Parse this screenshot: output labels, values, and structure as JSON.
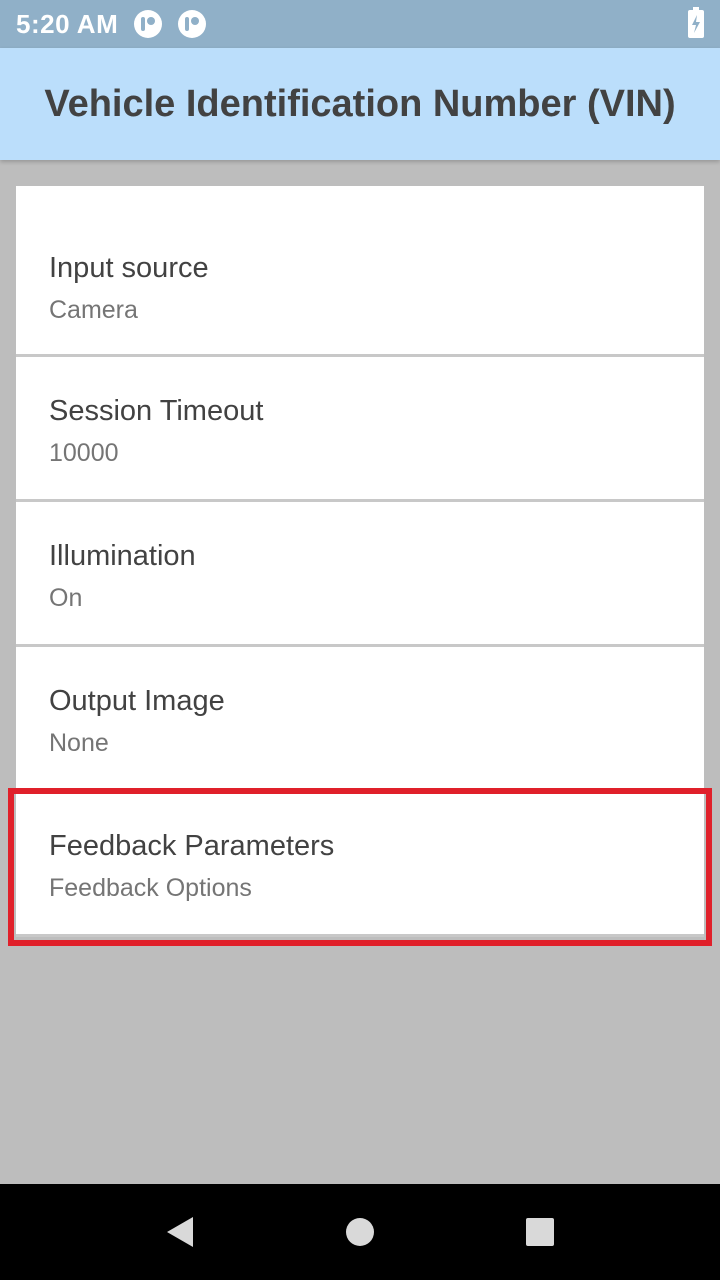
{
  "status_bar": {
    "time": "5:20 AM",
    "icons": [
      "app-notification-icon",
      "app-notification-icon",
      "battery-charging-icon"
    ]
  },
  "app_bar": {
    "title": "Vehicle Identification Number (VIN)"
  },
  "settings": [
    {
      "title": "Input source",
      "value": "Camera"
    },
    {
      "title": "Session Timeout",
      "value": "10000"
    },
    {
      "title": "Illumination",
      "value": "On"
    },
    {
      "title": "Output Image",
      "value": "None"
    },
    {
      "title": "Feedback Parameters",
      "value": "Feedback Options"
    }
  ],
  "highlight": {
    "target": "Feedback Parameters",
    "color": "#e0202a"
  },
  "nav_bar": {
    "buttons": [
      "back-icon",
      "home-icon",
      "recents-icon"
    ]
  },
  "colors": {
    "app_bar": "#bbdefb",
    "status_bar": "#90b0c8",
    "background": "#bdbdbd"
  }
}
